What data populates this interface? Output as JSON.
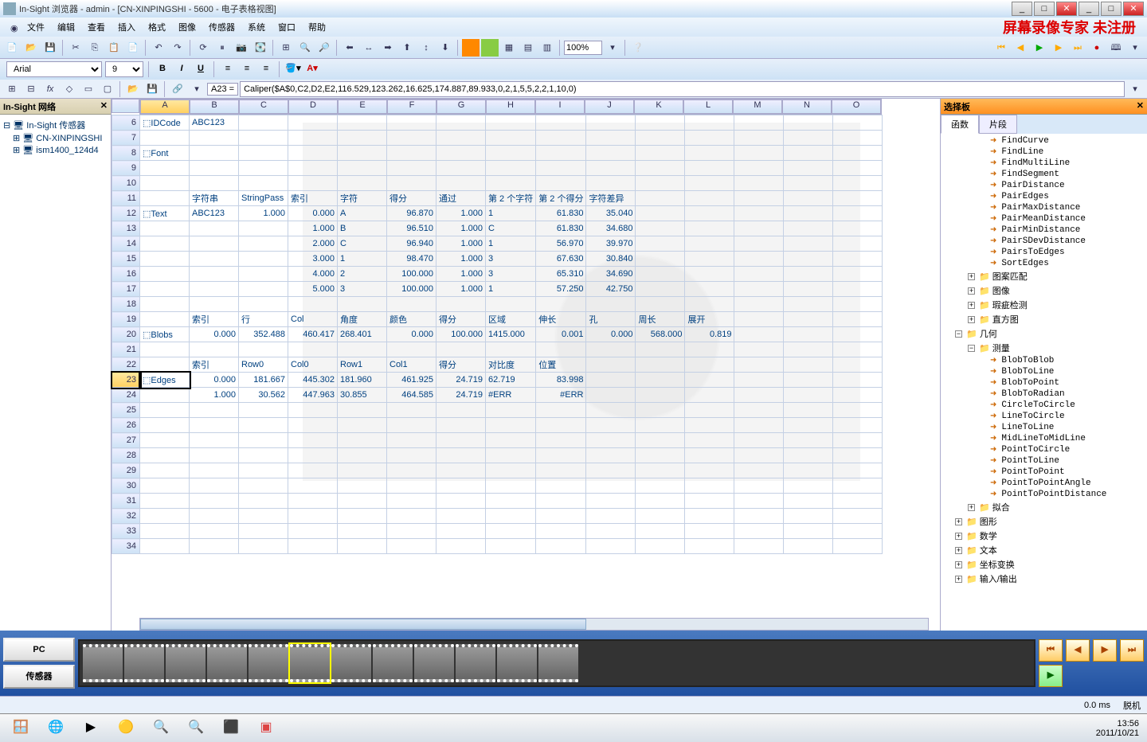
{
  "title": "In-Sight 浏览器 - admin - [CN-XINPINGSHI - 5600 - 电子表格视图]",
  "watermark": "屏幕录像专家 未注册",
  "menus": [
    "文件",
    "编辑",
    "查看",
    "插入",
    "格式",
    "图像",
    "传感器",
    "系统",
    "窗口",
    "帮助"
  ],
  "font": {
    "name": "Arial",
    "size": "9"
  },
  "zoom": "100%",
  "cell_ref": "A23 =",
  "formula": "Caliper($A$0,C2,D2,E2,116.529,123.262,16.625,174.887,89.933,0,2,1,5,5,2,2,1,10,0)",
  "left_panel": {
    "title": "In-Sight 网络",
    "root": "In-Sight 传感器",
    "nodes": [
      "CN-XINPINGSHI",
      "ism1400_124d4"
    ]
  },
  "columns": [
    "A",
    "B",
    "C",
    "D",
    "E",
    "F",
    "G",
    "H",
    "I",
    "J",
    "K",
    "L",
    "M",
    "N",
    "O"
  ],
  "rows": {
    "6": {
      "A": "⬚IDCode",
      "B": "ABC123"
    },
    "7": {},
    "8": {
      "A": "⬚Font"
    },
    "9": {},
    "10": {},
    "11": {
      "B": "字符串",
      "C": "StringPass",
      "D": "索引",
      "E": "字符",
      "F": "得分",
      "G": "通过",
      "H": "第 2 个字符",
      "I": "第 2 个得分",
      "J": "字符差异"
    },
    "12": {
      "A": "⬚Text",
      "B": "ABC123",
      "C": "1.000",
      "D": "0.000",
      "E": "A",
      "F": "96.870",
      "G": "1.000",
      "H": "1",
      "I": "61.830",
      "J": "35.040"
    },
    "13": {
      "D": "1.000",
      "E": "B",
      "F": "96.510",
      "G": "1.000",
      "H": "C",
      "I": "61.830",
      "J": "34.680"
    },
    "14": {
      "D": "2.000",
      "E": "C",
      "F": "96.940",
      "G": "1.000",
      "H": "1",
      "I": "56.970",
      "J": "39.970"
    },
    "15": {
      "D": "3.000",
      "E": "1",
      "F": "98.470",
      "G": "1.000",
      "H": "3",
      "I": "67.630",
      "J": "30.840"
    },
    "16": {
      "D": "4.000",
      "E": "2",
      "F": "100.000",
      "G": "1.000",
      "H": "3",
      "I": "65.310",
      "J": "34.690"
    },
    "17": {
      "D": "5.000",
      "E": "3",
      "F": "100.000",
      "G": "1.000",
      "H": "1",
      "I": "57.250",
      "J": "42.750"
    },
    "18": {},
    "19": {
      "B": "索引",
      "C": "行",
      "D": "Col",
      "E": "角度",
      "F": "颜色",
      "G": "得分",
      "H": "区域",
      "I": "伸长",
      "J": "孔",
      "K": "周长",
      "L": "展开"
    },
    "20": {
      "A": "⬚Blobs",
      "B": "0.000",
      "C": "352.488",
      "D": "460.417",
      "E": "268.401",
      "F": "0.000",
      "G": "100.000",
      "H": "1415.000",
      "I": "0.001",
      "J": "0.000",
      "K": "568.000",
      "L": "0.819"
    },
    "21": {},
    "22": {
      "B": "索引",
      "C": "Row0",
      "D": "Col0",
      "E": "Row1",
      "F": "Col1",
      "G": "得分",
      "H": "对比度",
      "I": "位置"
    },
    "23": {
      "A": "⬚Edges",
      "B": "0.000",
      "C": "181.667",
      "D": "445.302",
      "E": "181.960",
      "F": "461.925",
      "G": "24.719",
      "H": "62.719",
      "I": "83.998"
    },
    "24": {
      "B": "1.000",
      "C": "30.562",
      "D": "447.963",
      "E": "30.855",
      "F": "464.585",
      "G": "24.719",
      "H": "#ERR",
      "I": "#ERR"
    },
    "25": {},
    "26": {},
    "27": {},
    "28": {},
    "29": {},
    "30": {},
    "31": {},
    "32": {},
    "33": {},
    "34": {}
  },
  "selected_row": 23,
  "right_panel": {
    "title": "选择板",
    "tabs": [
      "函数",
      "片段"
    ],
    "active_tab": 0,
    "leaves": [
      "FindCurve",
      "FindLine",
      "FindMultiLine",
      "FindSegment",
      "PairDistance",
      "PairEdges",
      "PairMaxDistance",
      "PairMeanDistance",
      "PairMinDistance",
      "PairSDevDistance",
      "PairsToEdges",
      "SortEdges"
    ],
    "nodes": [
      {
        "lvl": 2,
        "exp": "+",
        "label": "图案匹配"
      },
      {
        "lvl": 2,
        "exp": "+",
        "label": "图像"
      },
      {
        "lvl": 2,
        "exp": "+",
        "label": "瑕疵检测"
      },
      {
        "lvl": 2,
        "exp": "+",
        "label": "直方图"
      },
      {
        "lvl": 1,
        "exp": "−",
        "label": "几何"
      },
      {
        "lvl": 2,
        "exp": "−",
        "label": "测量"
      }
    ],
    "measure_leaves": [
      "BlobToBlob",
      "BlobToLine",
      "BlobToPoint",
      "BlobToRadian",
      "CircleToCircle",
      "LineToCircle",
      "LineToLine",
      "MidLineToMidLine",
      "PointToCircle",
      "PointToLine",
      "PointToPoint",
      "PointToPointAngle",
      "PointToPointDistance"
    ],
    "tail_nodes": [
      {
        "lvl": 2,
        "exp": "+",
        "label": "拟合"
      },
      {
        "lvl": 1,
        "exp": "+",
        "label": "图形"
      },
      {
        "lvl": 1,
        "exp": "+",
        "label": "数学"
      },
      {
        "lvl": 1,
        "exp": "+",
        "label": "文本"
      },
      {
        "lvl": 1,
        "exp": "+",
        "label": "坐标变换"
      },
      {
        "lvl": 1,
        "exp": "+",
        "label": "输入/输出"
      }
    ]
  },
  "film": {
    "pc": "PC",
    "sensor": "传感器"
  },
  "status": {
    "time": "0.0 ms",
    "mode": "脱机"
  },
  "clock": {
    "time": "13:56",
    "date": "2011/10/21"
  }
}
